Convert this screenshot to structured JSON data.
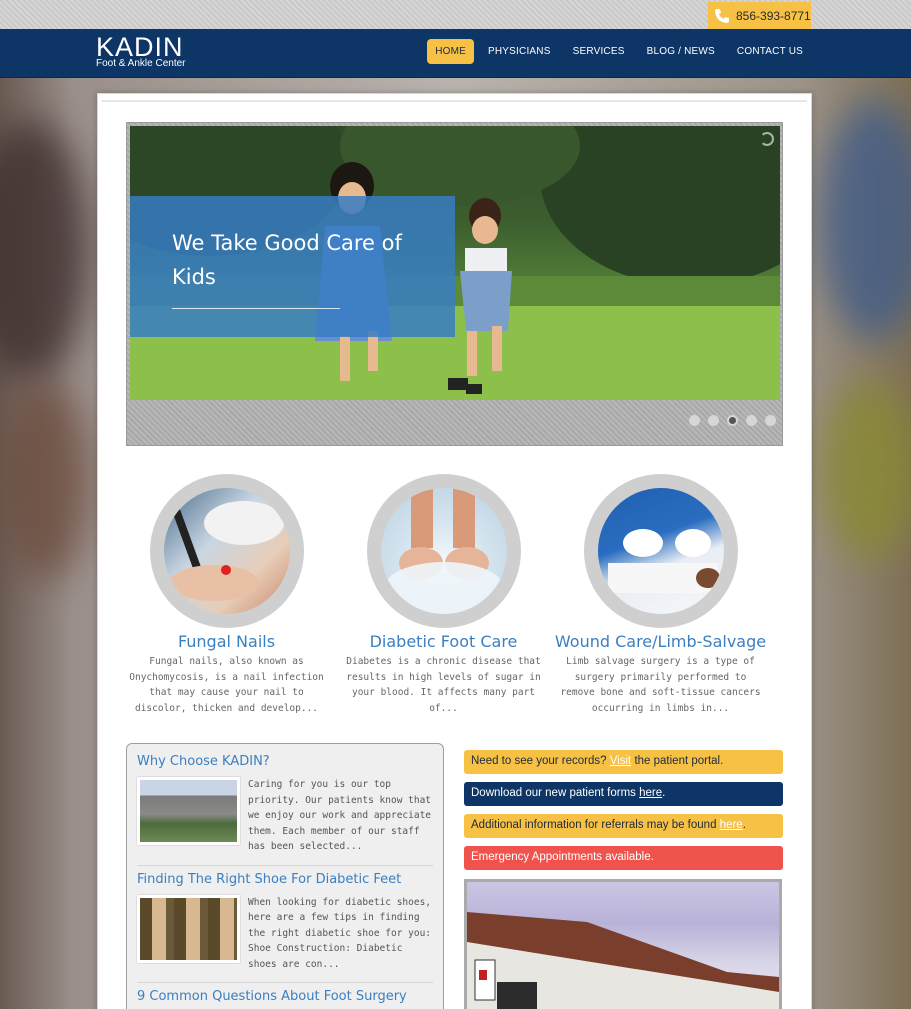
{
  "header": {
    "phone": "856-393-8771",
    "logo_main": "KADIN",
    "logo_sub": "Foot & Ankle Center",
    "nav": [
      {
        "label": "HOME",
        "active": true
      },
      {
        "label": "PHYSICIANS",
        "active": false
      },
      {
        "label": "SERVICES",
        "active": false
      },
      {
        "label": "BLOG / NEWS",
        "active": false
      },
      {
        "label": "CONTACT US",
        "active": false
      }
    ]
  },
  "slider": {
    "caption": "We Take Good Care of Kids",
    "dots": 5,
    "active_dot": 3
  },
  "services": [
    {
      "title": "Fungal Nails",
      "desc": "Fungal nails, also known as Onychomycosis, is a nail infection that may cause your nail to discolor, thicken and develop..."
    },
    {
      "title": "Diabetic Foot Care",
      "desc": "Diabetes is a chronic disease that results in high levels of sugar in your blood. It affects many part of..."
    },
    {
      "title": "Wound Care/Limb-Salvage",
      "desc": "Limb salvage surgery is a type of surgery primarily performed to remove bone and soft-tissue cancers occurring in limbs in..."
    }
  ],
  "posts": [
    {
      "title": "Why Choose KADIN?",
      "excerpt": "Caring for you is our top priority. Our patients know that we enjoy our work and appreciate them. Each member of our staff has been selected..."
    },
    {
      "title": "Finding The Right Shoe For Diabetic Feet",
      "excerpt": "When looking for diabetic shoes, here are a few tips in finding the right diabetic shoe for you: Shoe Construction: Diabetic shoes are con..."
    },
    {
      "title": "9 Common Questions About Foot Surgery",
      "excerpt": ""
    }
  ],
  "notices": {
    "records_pre": "Need to see your records? ",
    "records_link": "Visit",
    "records_post": " the patient portal.",
    "forms_pre": "Download our new patient forms ",
    "forms_link": "here",
    "forms_post": ".",
    "referrals_pre": "Additional information for referrals may be found ",
    "referrals_link": "here",
    "referrals_post": ".",
    "emergency": "Emergency Appointments available."
  },
  "colors": {
    "navy": "#0d3566",
    "yellow": "#f6c145",
    "blue_title": "#3a7fc1",
    "red": "#f0534c"
  }
}
